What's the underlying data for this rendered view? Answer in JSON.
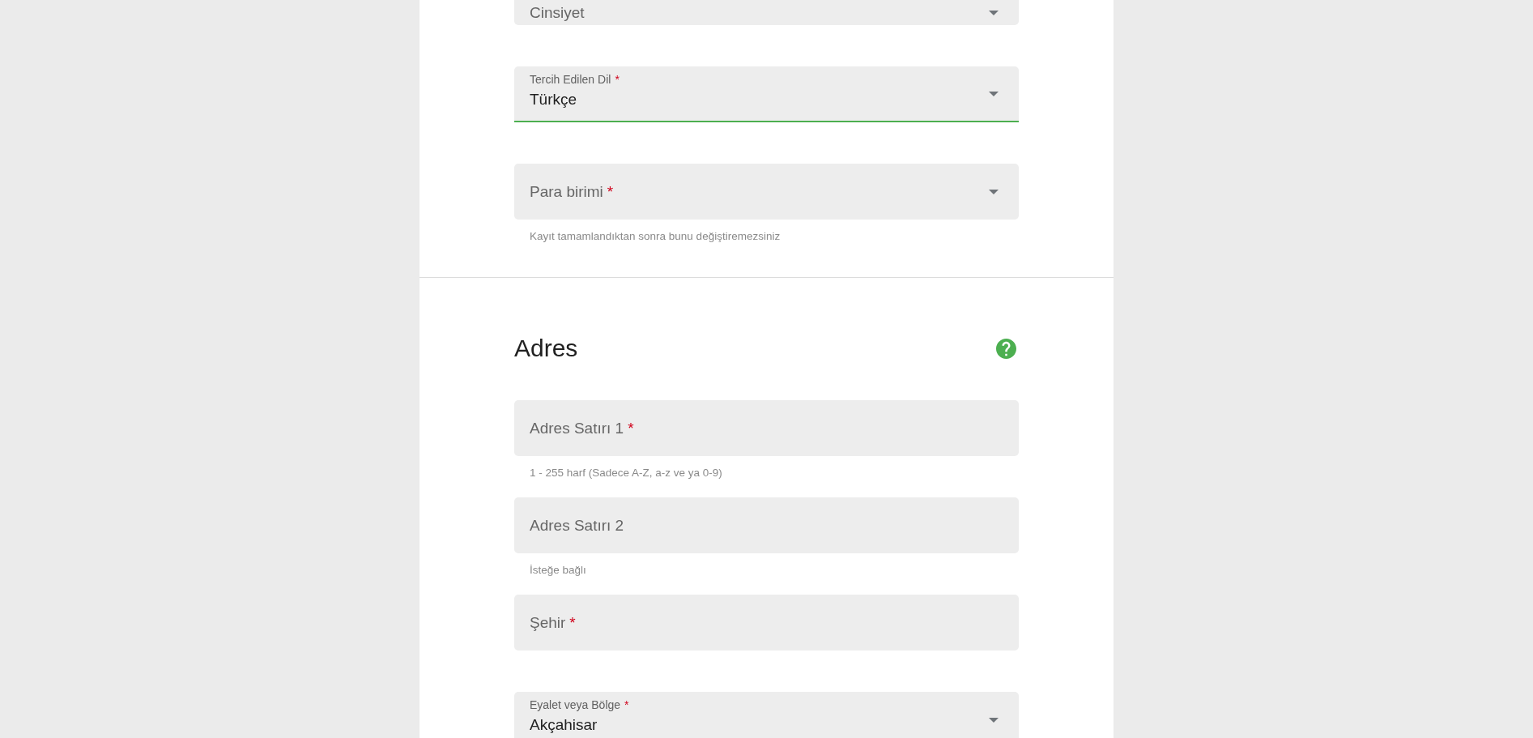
{
  "sections": [
    {
      "fields": [
        {
          "kind": "select",
          "label": "Cinsiyet",
          "focused": false
        },
        {
          "kind": "select",
          "label": "Tercih Edilen Dil",
          "required_mark": "*",
          "value": "Türkçe",
          "focused": true
        },
        {
          "kind": "select",
          "label": "Para birimi",
          "required_mark": "*",
          "focused": false,
          "helper": "Kayıt tamamlandıktan sonra bunu değiştiremezsiniz"
        }
      ]
    },
    {
      "title": "Adres",
      "fields": [
        {
          "kind": "text",
          "label": "Adres Satırı 1",
          "required_mark": "*",
          "focused": false,
          "helper": "1 - 255 harf (Sadece A-Z, a-z ve ya 0-9)"
        },
        {
          "kind": "text",
          "label": "Adres Satırı 2",
          "focused": false,
          "helper": "İsteğe bağlı"
        },
        {
          "kind": "text",
          "label": "Şehir",
          "required_mark": "*",
          "focused": false
        },
        {
          "kind": "select",
          "label": "Eyalet veya Bölge",
          "required_mark": "*",
          "value": "Akçahisar",
          "focused": false
        }
      ]
    }
  ]
}
